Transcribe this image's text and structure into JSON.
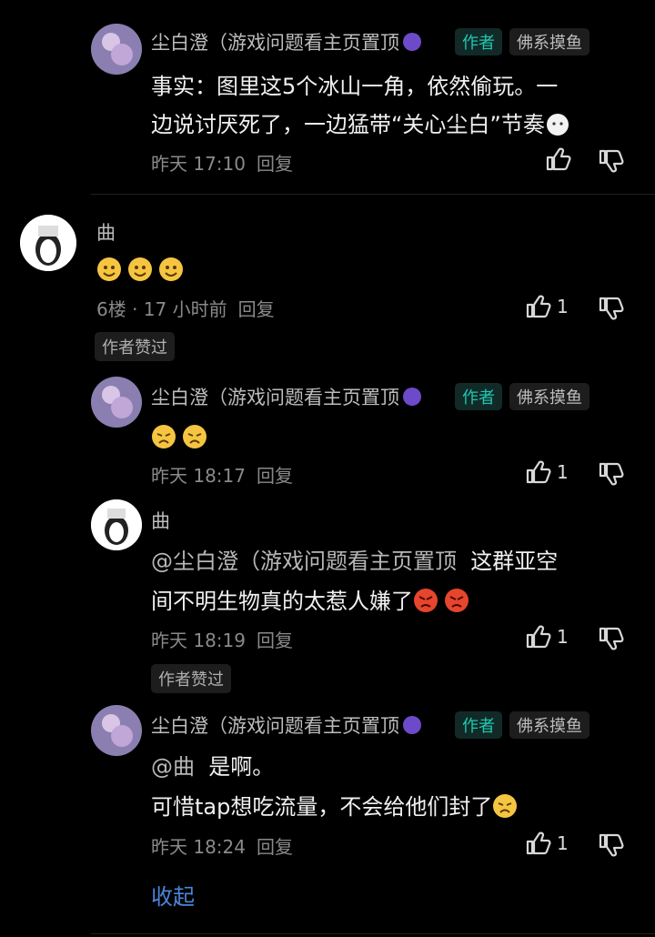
{
  "comments": [
    {
      "name": "尘白澄（游戏问题看主页置顶",
      "author_tag": "作者",
      "title_tag": "佛系摸鱼",
      "text_line1": "事实：图里这5个冰山一角，依然偷玩。一",
      "text_line2": "边说讨厌死了，一边猛带“关心尘白”节奏",
      "time": "昨天 17:10",
      "reply": "回复"
    },
    {
      "name": "曲",
      "floor_time": "6楼 · 17 小时前",
      "reply": "回复",
      "likes": "1",
      "liked_badge": "作者赞过"
    },
    {
      "name": "尘白澄（游戏问题看主页置顶",
      "author_tag": "作者",
      "title_tag": "佛系摸鱼",
      "time": "昨天 18:17",
      "reply": "回复",
      "likes": "1"
    },
    {
      "name": "曲",
      "mention": "@尘白澄（游戏问题看主页置顶",
      "text_line1": "这群亚空",
      "text_line2": "间不明生物真的太惹人嫌了",
      "time": "昨天 18:19",
      "reply": "回复",
      "likes": "1",
      "liked_badge": "作者赞过"
    },
    {
      "name": "尘白澄（游戏问题看主页置顶",
      "author_tag": "作者",
      "title_tag": "佛系摸鱼",
      "mention": "@曲",
      "text_line1": "是啊。",
      "text_line2": "可惜tap想吃流量，不会给他们封了",
      "time": "昨天 18:24",
      "reply": "回复",
      "likes": "1"
    }
  ],
  "collapse": "收起",
  "icons": [
    "thumb-up-icon",
    "thumb-down-icon",
    "emoji-icon",
    "vip-badge-icon"
  ]
}
